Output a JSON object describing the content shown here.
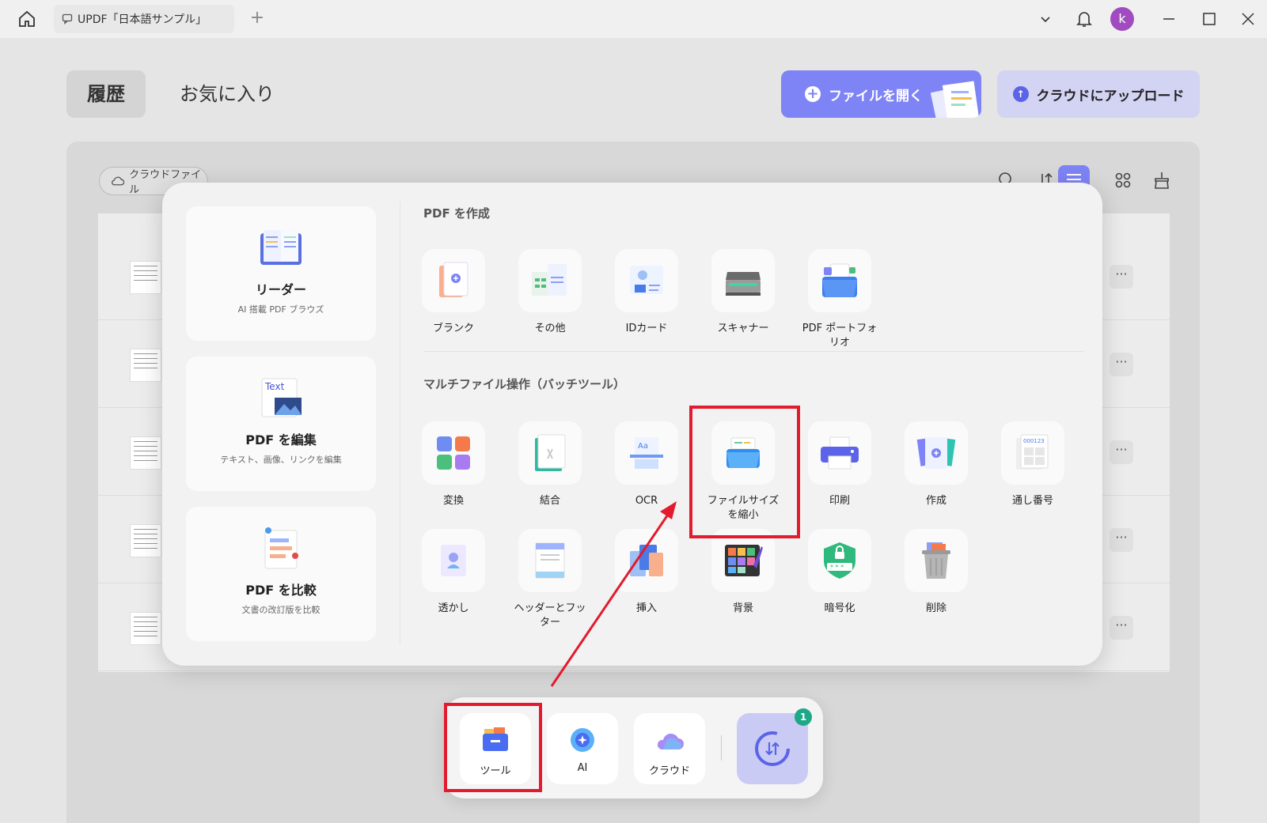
{
  "titlebar": {
    "tab_title": "UPDF「日本語サンプル」",
    "avatar_letter": "k"
  },
  "header": {
    "tab_history": "履歴",
    "tab_favorites": "お気に入り",
    "open_file": "ファイルを開く",
    "upload_cloud": "クラウドにアップロード"
  },
  "list": {
    "cloud_filter": "クラウドファイル",
    "more_label": "···"
  },
  "popup": {
    "sidebar": [
      {
        "title": "リーダー",
        "subtitle": "AI 搭載 PDF ブラウズ"
      },
      {
        "title": "PDF を編集",
        "subtitle": "テキスト、画像、リンクを編集"
      },
      {
        "title": "PDF を比較",
        "subtitle": "文書の改訂版を比較"
      }
    ],
    "create_section": "PDF を作成",
    "create_tools": [
      "ブランク",
      "その他",
      "IDカード",
      "スキャナー",
      "PDF ポートフォリオ"
    ],
    "batch_section": "マルチファイル操作（バッチツール）",
    "batch_tools_row1": [
      "変換",
      "結合",
      "OCR",
      "ファイルサイズを縮小",
      "印刷",
      "作成",
      "通し番号"
    ],
    "batch_tools_row2": [
      "透かし",
      "ヘッダーとフッター",
      "挿入",
      "背景",
      "暗号化",
      "削除"
    ]
  },
  "dock": {
    "tools": "ツール",
    "ai": "AI",
    "cloud": "クラウド",
    "badge_count": "1"
  },
  "colors": {
    "accent": "#7e84f5",
    "highlight": "#e21b2e",
    "badge": "#1fa887"
  }
}
